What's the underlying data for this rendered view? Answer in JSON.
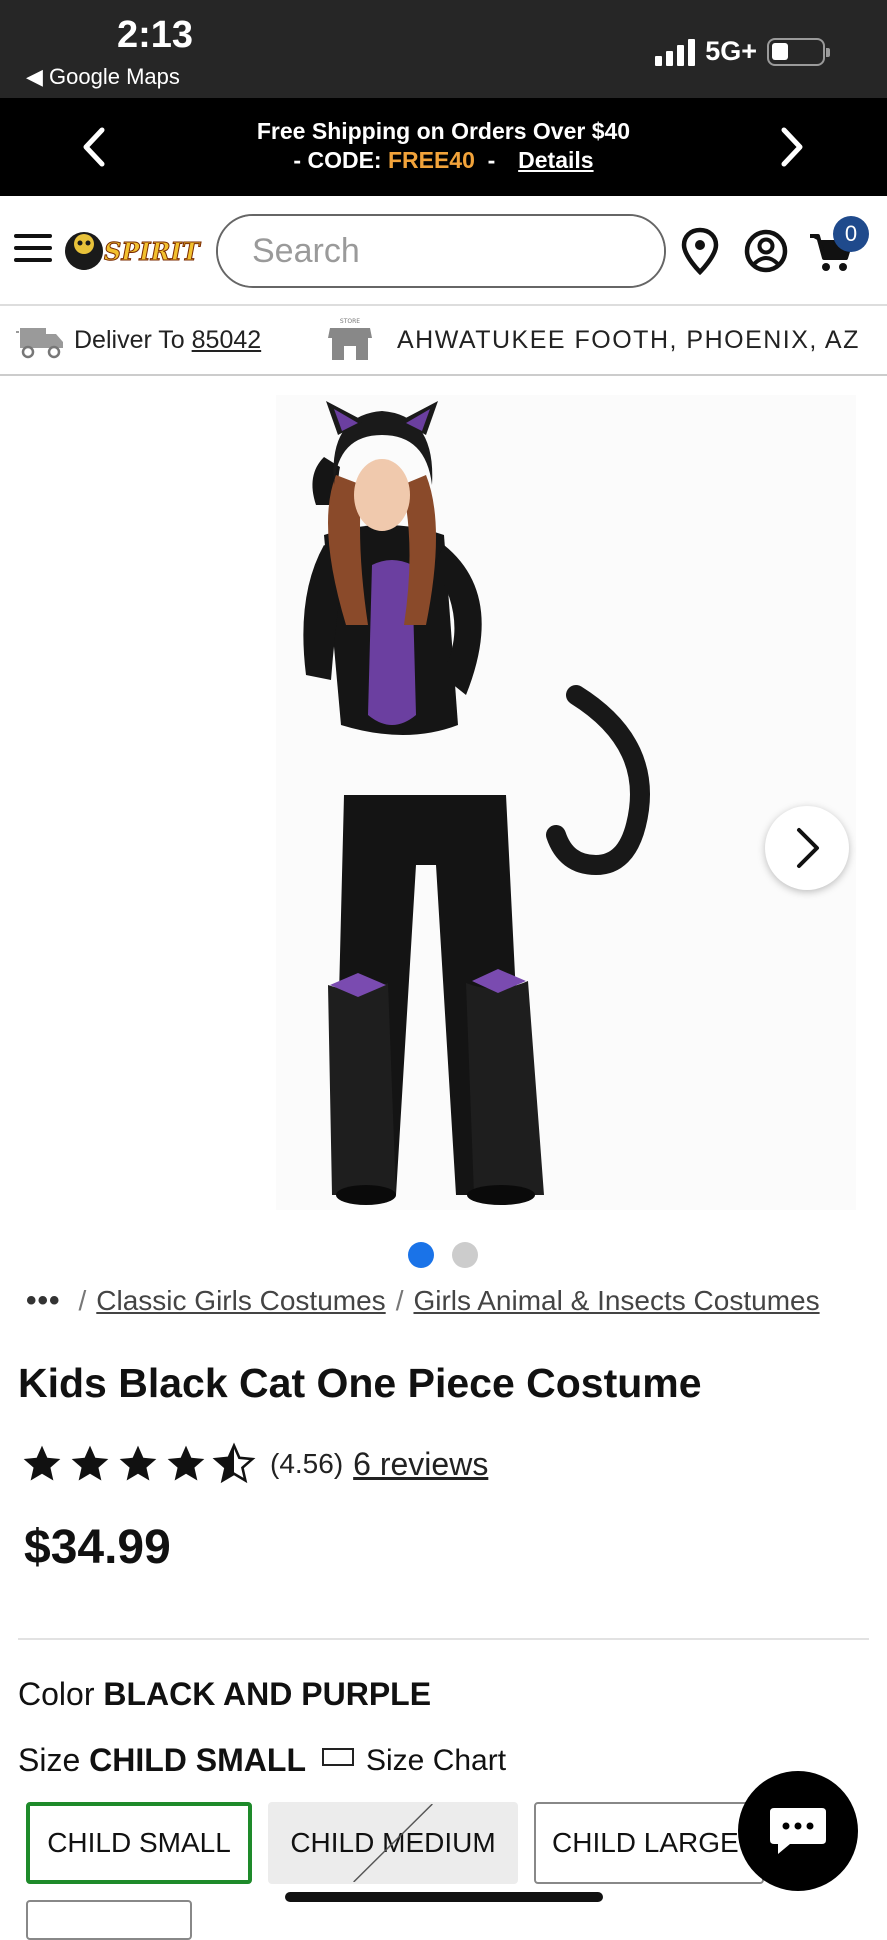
{
  "status_bar": {
    "time": "2:13",
    "back_app": "◀ Google Maps",
    "network": "5G+"
  },
  "promo": {
    "line1": "Free Shipping on Orders Over $40",
    "line2_prefix": "- CODE: ",
    "code": "FREE40",
    "line2_sep": "  -  ",
    "details_link": "Details"
  },
  "header": {
    "logo_text": "SPIRIT",
    "search_placeholder": "Search",
    "cart_count": "0"
  },
  "delivery": {
    "label": "Deliver To ",
    "zip": "85042",
    "store": "AHWATUKEE FOOTH, PHOENIX, AZ",
    "store_icon_label": "STORE"
  },
  "gallery": {
    "total_images": 2,
    "active_index": 0
  },
  "breadcrumb": {
    "more": "•••",
    "items": [
      "Classic Girls Costumes",
      "Girls Animal & Insects Costumes"
    ]
  },
  "product": {
    "title": "Kids Black Cat One Piece Costume",
    "rating_value": 4.56,
    "rating_text": "(4.56)",
    "reviews": "6 reviews",
    "price": "$34.99"
  },
  "options": {
    "color_label": "Color ",
    "color_value": "BLACK AND PURPLE",
    "size_label": "Size ",
    "size_value": "CHILD SMALL",
    "size_chart": "Size Chart",
    "sizes": [
      "CHILD SMALL",
      "CHILD MEDIUM",
      "CHILD LARGE"
    ]
  },
  "colors": {
    "promo_code": "#f2a33a",
    "selected_size": "#1e8a2a",
    "active_dot": "#1a73e8",
    "cart_badge": "#1f4a8c"
  }
}
